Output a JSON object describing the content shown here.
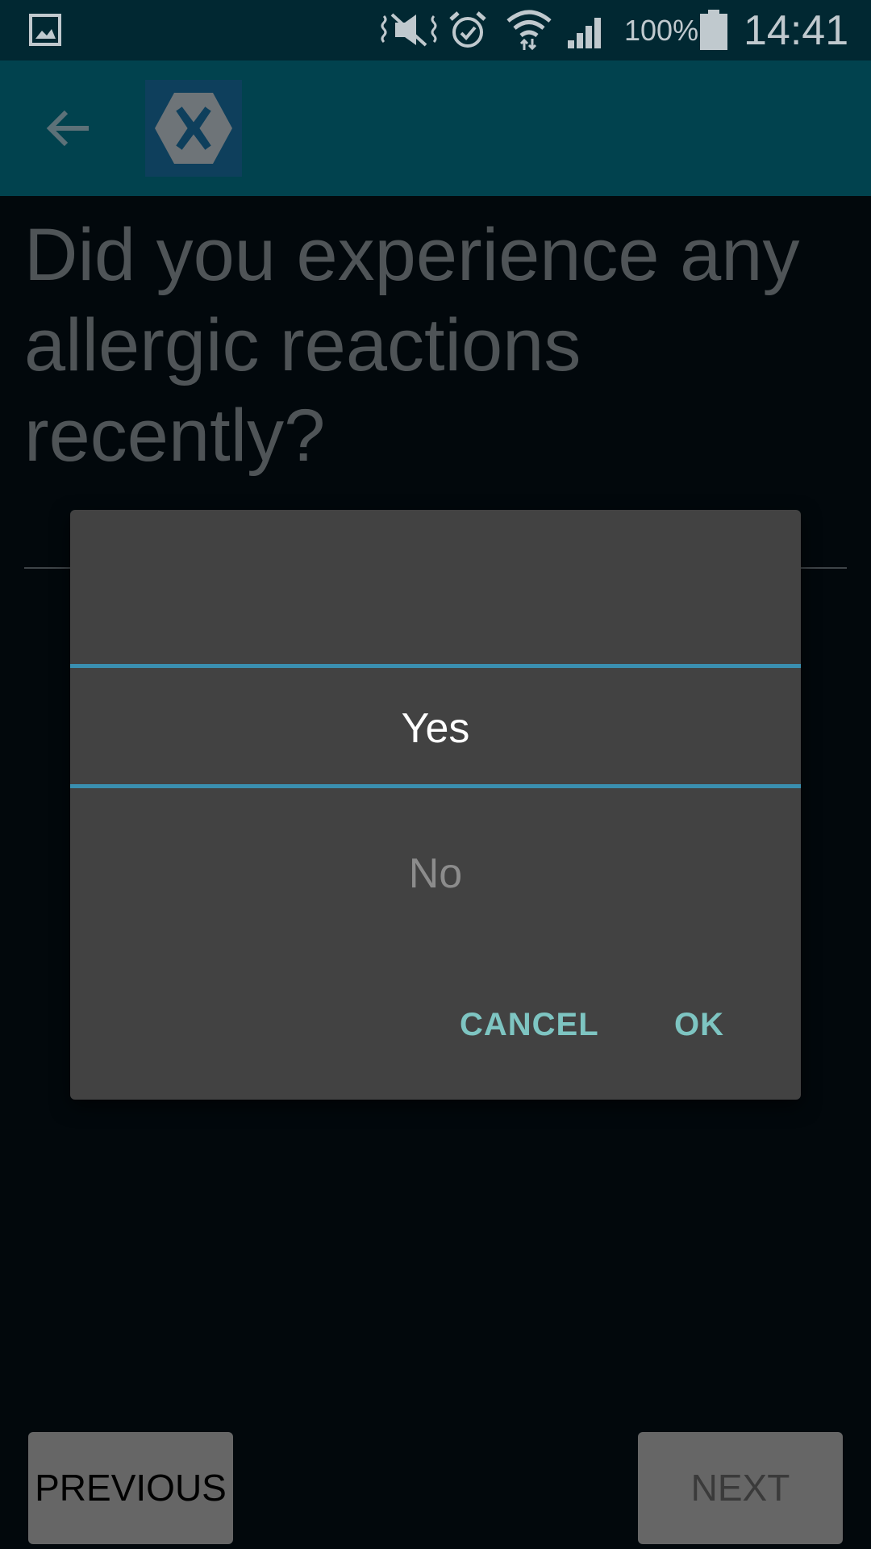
{
  "status_bar": {
    "battery_percent": "100%",
    "time": "14:41",
    "icons": [
      "gallery-icon",
      "mute-icon",
      "alarm-icon",
      "wifi-icon",
      "signal-icon",
      "battery-icon"
    ],
    "color": "#c0c9ce"
  },
  "toolbar": {
    "icons": [
      "back-arrow-icon",
      "xamarin-logo-icon"
    ],
    "background": "#01424e"
  },
  "question": {
    "text": "Did you experience any allergic reactions recently?"
  },
  "picker_dialog": {
    "options": [
      "Yes",
      "No"
    ],
    "selected": "Yes",
    "cancel_label": "CANCEL",
    "ok_label": "OK",
    "accent_color": "#7ec5c2",
    "divider_color": "#3a8fb0"
  },
  "navigation": {
    "previous_label": "PREVIOUS",
    "next_label": "NEXT"
  }
}
